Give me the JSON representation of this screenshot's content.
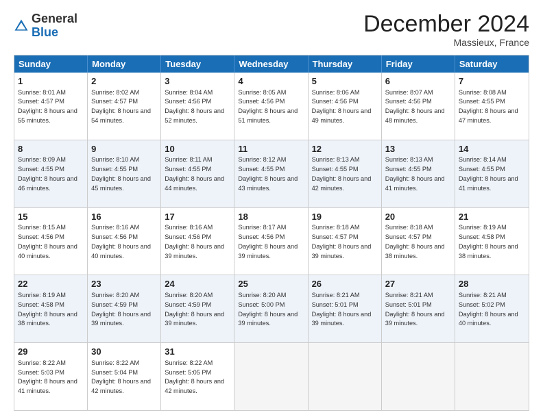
{
  "logo": {
    "general": "General",
    "blue": "Blue"
  },
  "title": "December 2024",
  "location": "Massieux, France",
  "weekdays": [
    "Sunday",
    "Monday",
    "Tuesday",
    "Wednesday",
    "Thursday",
    "Friday",
    "Saturday"
  ],
  "weeks": [
    [
      {
        "day": "1",
        "sunrise": "8:01 AM",
        "sunset": "4:57 PM",
        "daylight": "8 hours and 55 minutes."
      },
      {
        "day": "2",
        "sunrise": "8:02 AM",
        "sunset": "4:57 PM",
        "daylight": "8 hours and 54 minutes."
      },
      {
        "day": "3",
        "sunrise": "8:04 AM",
        "sunset": "4:56 PM",
        "daylight": "8 hours and 52 minutes."
      },
      {
        "day": "4",
        "sunrise": "8:05 AM",
        "sunset": "4:56 PM",
        "daylight": "8 hours and 51 minutes."
      },
      {
        "day": "5",
        "sunrise": "8:06 AM",
        "sunset": "4:56 PM",
        "daylight": "8 hours and 49 minutes."
      },
      {
        "day": "6",
        "sunrise": "8:07 AM",
        "sunset": "4:56 PM",
        "daylight": "8 hours and 48 minutes."
      },
      {
        "day": "7",
        "sunrise": "8:08 AM",
        "sunset": "4:55 PM",
        "daylight": "8 hours and 47 minutes."
      }
    ],
    [
      {
        "day": "8",
        "sunrise": "8:09 AM",
        "sunset": "4:55 PM",
        "daylight": "8 hours and 46 minutes."
      },
      {
        "day": "9",
        "sunrise": "8:10 AM",
        "sunset": "4:55 PM",
        "daylight": "8 hours and 45 minutes."
      },
      {
        "day": "10",
        "sunrise": "8:11 AM",
        "sunset": "4:55 PM",
        "daylight": "8 hours and 44 minutes."
      },
      {
        "day": "11",
        "sunrise": "8:12 AM",
        "sunset": "4:55 PM",
        "daylight": "8 hours and 43 minutes."
      },
      {
        "day": "12",
        "sunrise": "8:13 AM",
        "sunset": "4:55 PM",
        "daylight": "8 hours and 42 minutes."
      },
      {
        "day": "13",
        "sunrise": "8:13 AM",
        "sunset": "4:55 PM",
        "daylight": "8 hours and 41 minutes."
      },
      {
        "day": "14",
        "sunrise": "8:14 AM",
        "sunset": "4:55 PM",
        "daylight": "8 hours and 41 minutes."
      }
    ],
    [
      {
        "day": "15",
        "sunrise": "8:15 AM",
        "sunset": "4:56 PM",
        "daylight": "8 hours and 40 minutes."
      },
      {
        "day": "16",
        "sunrise": "8:16 AM",
        "sunset": "4:56 PM",
        "daylight": "8 hours and 40 minutes."
      },
      {
        "day": "17",
        "sunrise": "8:16 AM",
        "sunset": "4:56 PM",
        "daylight": "8 hours and 39 minutes."
      },
      {
        "day": "18",
        "sunrise": "8:17 AM",
        "sunset": "4:56 PM",
        "daylight": "8 hours and 39 minutes."
      },
      {
        "day": "19",
        "sunrise": "8:18 AM",
        "sunset": "4:57 PM",
        "daylight": "8 hours and 39 minutes."
      },
      {
        "day": "20",
        "sunrise": "8:18 AM",
        "sunset": "4:57 PM",
        "daylight": "8 hours and 38 minutes."
      },
      {
        "day": "21",
        "sunrise": "8:19 AM",
        "sunset": "4:58 PM",
        "daylight": "8 hours and 38 minutes."
      }
    ],
    [
      {
        "day": "22",
        "sunrise": "8:19 AM",
        "sunset": "4:58 PM",
        "daylight": "8 hours and 38 minutes."
      },
      {
        "day": "23",
        "sunrise": "8:20 AM",
        "sunset": "4:59 PM",
        "daylight": "8 hours and 39 minutes."
      },
      {
        "day": "24",
        "sunrise": "8:20 AM",
        "sunset": "4:59 PM",
        "daylight": "8 hours and 39 minutes."
      },
      {
        "day": "25",
        "sunrise": "8:20 AM",
        "sunset": "5:00 PM",
        "daylight": "8 hours and 39 minutes."
      },
      {
        "day": "26",
        "sunrise": "8:21 AM",
        "sunset": "5:01 PM",
        "daylight": "8 hours and 39 minutes."
      },
      {
        "day": "27",
        "sunrise": "8:21 AM",
        "sunset": "5:01 PM",
        "daylight": "8 hours and 39 minutes."
      },
      {
        "day": "28",
        "sunrise": "8:21 AM",
        "sunset": "5:02 PM",
        "daylight": "8 hours and 40 minutes."
      }
    ],
    [
      {
        "day": "29",
        "sunrise": "8:22 AM",
        "sunset": "5:03 PM",
        "daylight": "8 hours and 41 minutes."
      },
      {
        "day": "30",
        "sunrise": "8:22 AM",
        "sunset": "5:04 PM",
        "daylight": "8 hours and 42 minutes."
      },
      {
        "day": "31",
        "sunrise": "8:22 AM",
        "sunset": "5:05 PM",
        "daylight": "8 hours and 42 minutes."
      },
      null,
      null,
      null,
      null
    ]
  ],
  "labels": {
    "sunrise": "Sunrise:",
    "sunset": "Sunset:",
    "daylight": "Daylight:"
  }
}
